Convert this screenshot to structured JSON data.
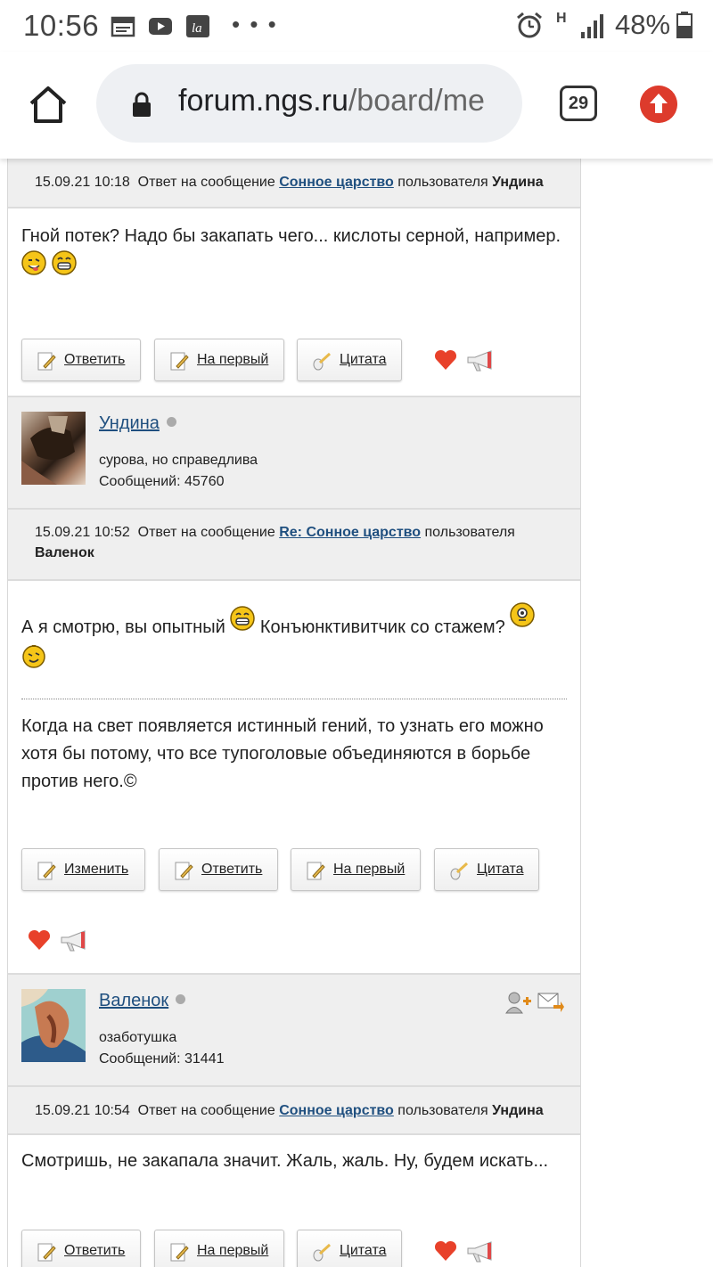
{
  "status_bar": {
    "time": "10:56",
    "icons": [
      "calendar-icon",
      "youtube-icon",
      "la-app-icon",
      "more-dots-icon"
    ],
    "dots": "• • •",
    "network_label": "H",
    "battery": "48%"
  },
  "browser": {
    "url_host": "forum.ngs.ru",
    "url_path": "/board/me",
    "tab_count": "29",
    "accent_color": "#dd3b2c"
  },
  "posts": [
    {
      "header": {
        "date": "15.09.21 10:18",
        "reply_to_prefix": "Ответ на сообщение",
        "topic_link": "Сонное царство",
        "user_prefix": "пользователя",
        "user": "Ундина"
      },
      "text": "Гной потек? Надо бы закапать чего... кислоты серной, например.",
      "buttons": {
        "reply": "Ответить",
        "to_first": "На первый",
        "quote": "Цитата"
      }
    },
    {
      "header": {
        "date": "15.09.21 10:52",
        "reply_to_prefix": "Ответ на сообщение",
        "topic_link": "Re: Сонное царство",
        "user_prefix": "пользователя",
        "user": "Валенок"
      },
      "text_a": "А я смотрю, вы опытный",
      "text_b": "Конъюнктивитчик со стажем?",
      "signature": "Когда на свет появляется истинный гений, то узнать его можно хотя бы потому, что все тупоголовые объединяются в борьбе против него.©",
      "buttons": {
        "edit": "Изменить",
        "reply": "Ответить",
        "to_first": "На первый",
        "quote": "Цитата"
      }
    },
    {
      "header": {
        "date": "15.09.21 10:54",
        "reply_to_prefix": "Ответ на сообщение",
        "topic_link": "Сонное царство",
        "user_prefix": "пользователя",
        "user": "Ундина"
      },
      "text": "Смотришь, не закапала значит. Жаль, жаль. Ну, будем искать...",
      "buttons": {
        "reply": "Ответить",
        "to_first": "На первый",
        "quote": "Цитата"
      }
    }
  ],
  "authors": [
    {
      "name": "Ундина",
      "status": "сурова, но справедлива",
      "count_label": "Сообщений: 45760"
    },
    {
      "name": "Валенок",
      "status": "озаботушка",
      "count_label": "Сообщений: 31441"
    }
  ]
}
